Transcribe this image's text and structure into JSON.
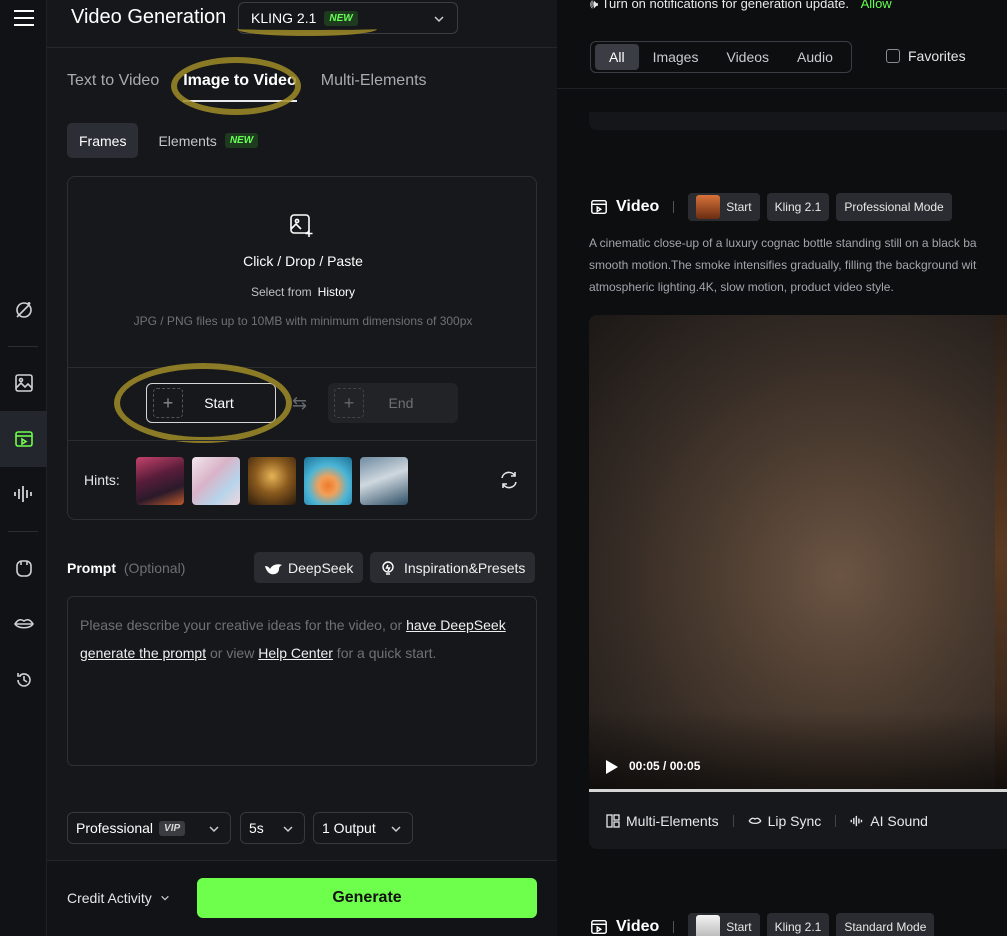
{
  "header": {
    "title": "Video Generation",
    "model": "KLING 2.1",
    "model_badge": "NEW"
  },
  "tabs": [
    {
      "label": "Text to Video"
    },
    {
      "label": "Image to Video"
    },
    {
      "label": "Multi-Elements"
    }
  ],
  "subtabs": {
    "frames": "Frames",
    "elements": "Elements",
    "elements_badge": "NEW"
  },
  "upload": {
    "title": "Click / Drop / Paste",
    "select_from": "Select from",
    "history": "History",
    "note": "JPG / PNG files up to 10MB with minimum dimensions of 300px",
    "start_label": "Start",
    "end_label": "End"
  },
  "hints": {
    "label": "Hints:"
  },
  "prompt": {
    "label": "Prompt",
    "optional": "(Optional)",
    "deepseek_btn": "DeepSeek",
    "inspiration_btn": "Inspiration&Presets",
    "placeholder_1": "Please describe your creative ideas for the video, or ",
    "link_deepseek": "have DeepSeek generate the prompt",
    "placeholder_2": " or view ",
    "link_help": "Help Center",
    "placeholder_3": " for a quick start."
  },
  "settings": {
    "mode": "Professional",
    "mode_badge": "VIP",
    "duration": "5s",
    "outputs": "1 Output"
  },
  "footer": {
    "credit": "Credit Activity",
    "generate": "Generate"
  },
  "right": {
    "notice": "Turn on notifications for generation update.",
    "allow": "Allow",
    "filters": [
      "All",
      "Images",
      "Videos",
      "Audio"
    ],
    "favorites": "Favorites",
    "card1": {
      "type": "Video",
      "chip_start": "Start",
      "chip_model": "Kling 2.1",
      "chip_mode": "Professional Mode",
      "desc_lines": [
        "A cinematic close-up of a luxury cognac bottle standing still on a black ba",
        "smooth motion.The smoke intensifies gradually, filling the background wit",
        "atmospheric lighting.4K, slow motion, product video style."
      ],
      "time": "00:05 / 00:05",
      "video_progress": 1.0,
      "actions": [
        "Multi-Elements",
        "Lip Sync",
        "AI Sound"
      ]
    },
    "card2": {
      "type": "Video",
      "chip_start": "Start",
      "chip_model": "Kling 2.1",
      "chip_mode": "Standard Mode"
    }
  },
  "colors": {
    "accent_green": "#6dff4b",
    "badge_green": "#66ff55",
    "highlight": "#a08c28"
  },
  "icons": [
    "menu-icon",
    "magic-wand-icon",
    "image-icon",
    "video-icon",
    "audio-icon",
    "avatar-icon",
    "lips-icon",
    "history-icon"
  ]
}
